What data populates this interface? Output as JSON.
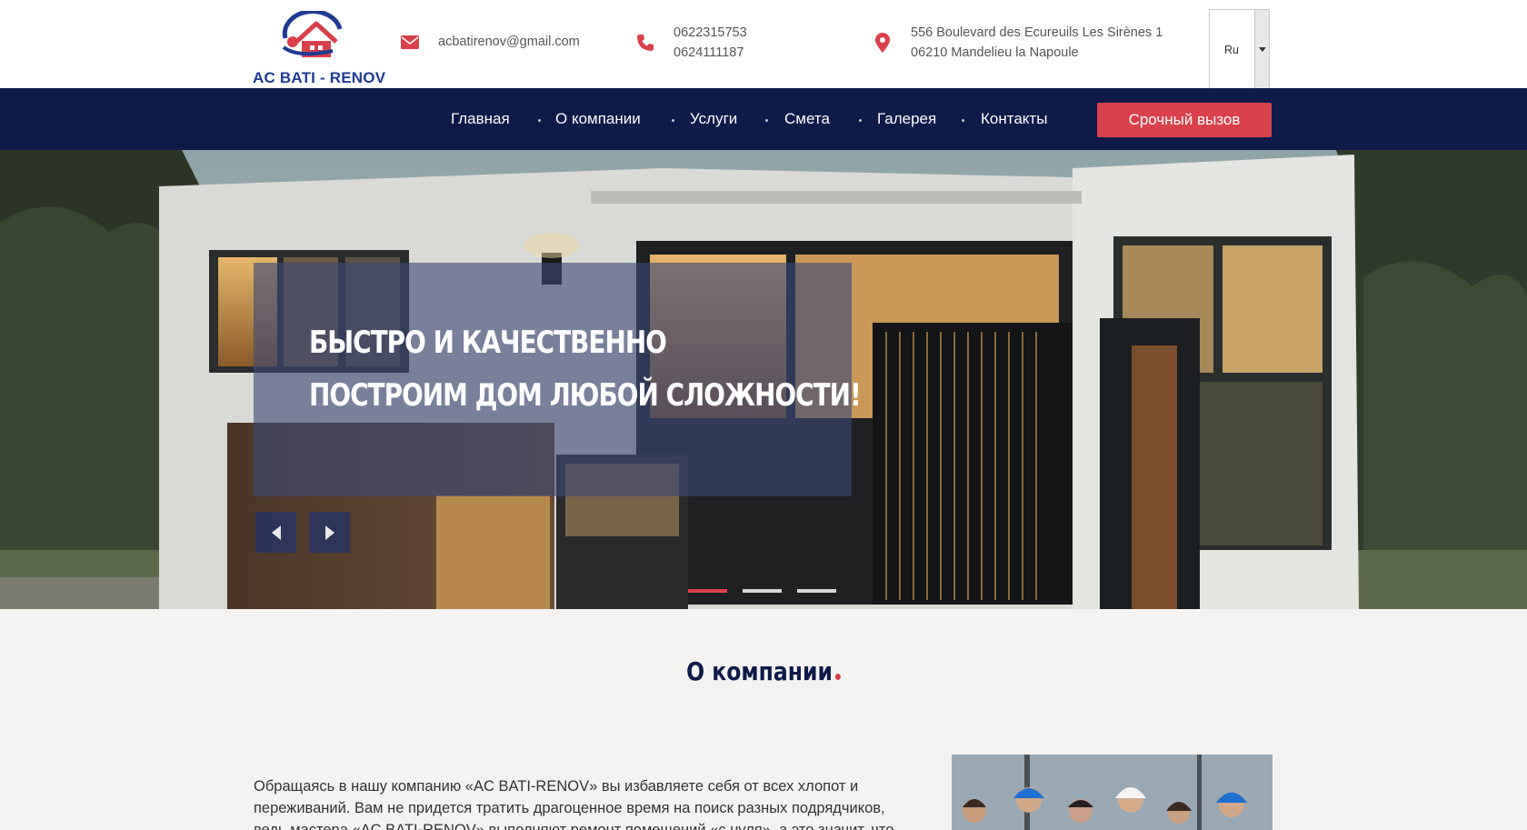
{
  "header": {
    "logo_text": "AC BATI - RENOV",
    "email": "acbatirenov@gmail.com",
    "phone_1": "0622315753",
    "phone_2": "0624111187",
    "address_line_1": "556 Boulevard des Ecureuils Les Sirènes 1",
    "address_line_2": "06210 Mandelieu la Napoule",
    "language_selected": "Ru"
  },
  "icons": {
    "email": "envelope-icon",
    "phone": "phone-icon",
    "address": "map-pin-icon",
    "prev": "chevron-left-icon",
    "next": "chevron-right-icon"
  },
  "colors": {
    "brand_navy": "#0e1a4a",
    "accent_red": "#d9404a",
    "logo_blue": "#1f3a93"
  },
  "nav": {
    "items": [
      "Главная",
      "О компании",
      "Услуги",
      "Смета",
      "Галерея",
      "Контакты"
    ],
    "cta_label": "Срочный вызов"
  },
  "hero": {
    "title_line_1": "БЫСТРО И КАЧЕСТВЕННО",
    "title_line_2": "ПОСТРОИМ ДОМ ЛЮБОЙ СЛОЖНОСТИ!",
    "slide_count": 3,
    "active_slide": 1
  },
  "about": {
    "title": "О компании",
    "text": "Обращаясь в нашу компанию «AC BATI-RENOV» вы избавляете себя от всех хлопот и переживаний. Вам не придется тратить драгоценное время на поиск разных подрядчиков, ведь мастера «AC BATI-RENOV» выполняют ремонт помещений «с нуля», а это значит, что"
  }
}
